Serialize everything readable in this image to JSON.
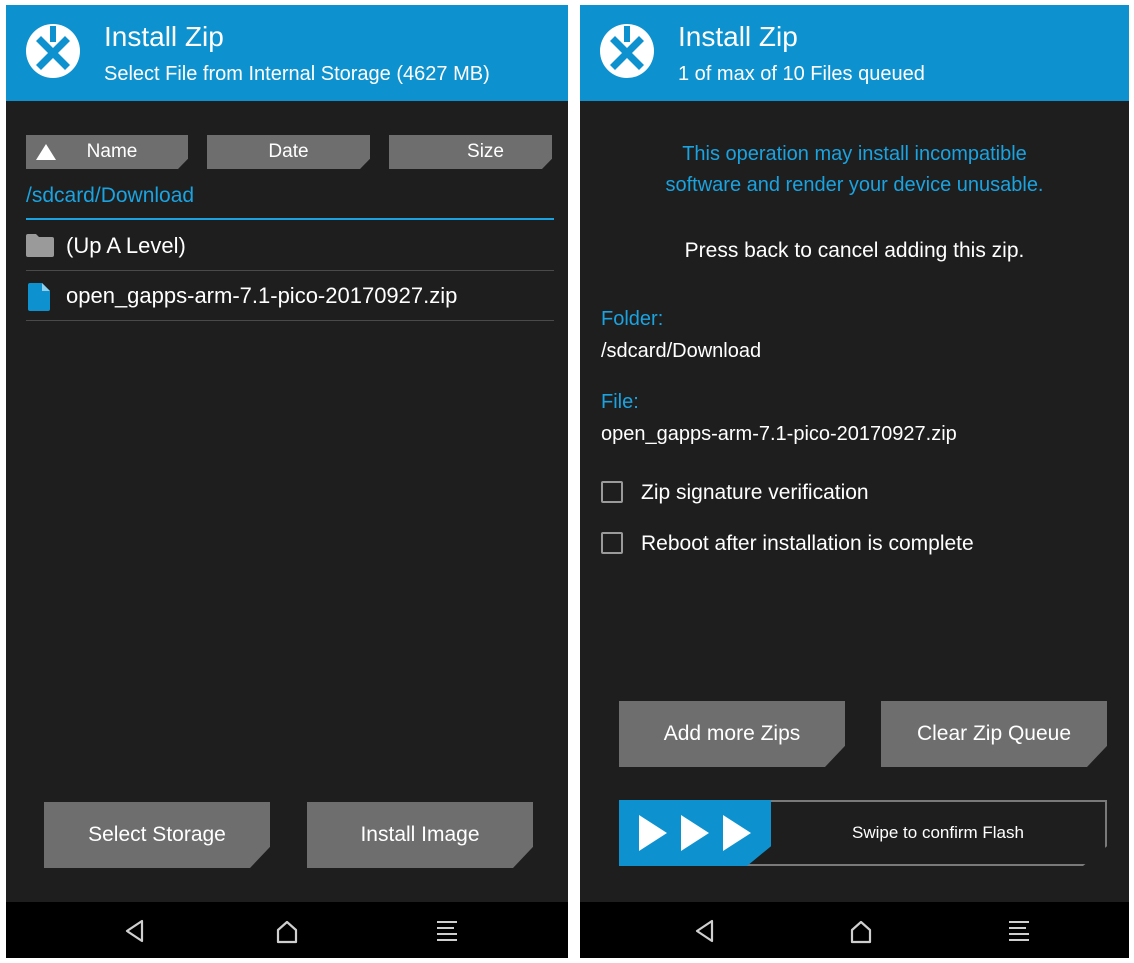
{
  "left": {
    "header": {
      "title": "Install Zip",
      "subtitle": "Select File from Internal Storage (4627 MB)"
    },
    "sort": {
      "name": "Name",
      "date": "Date",
      "size": "Size"
    },
    "path": "/sdcard/Download",
    "files": [
      {
        "name": "(Up A Level)",
        "icon": "folder-icon"
      },
      {
        "name": "open_gapps-arm-7.1-pico-20170927.zip",
        "icon": "file-icon"
      }
    ],
    "buttons": {
      "select_storage": "Select Storage",
      "install_image": "Install Image"
    }
  },
  "right": {
    "header": {
      "title": "Install Zip",
      "subtitle": "1 of max of 10 Files queued"
    },
    "warning": "This operation may install incompatible software and render your device unusable.",
    "warning_line1": "This operation may install incompatible",
    "warning_line2": "software and render your device unusable.",
    "press_back": "Press back to cancel adding this zip.",
    "folder_label": "Folder:",
    "folder_value": "/sdcard/Download",
    "file_label": "File:",
    "file_value": "open_gapps-arm-7.1-pico-20170927.zip",
    "options": [
      {
        "label": "Zip signature verification",
        "checked": false
      },
      {
        "label": "Reboot after installation is complete",
        "checked": false
      }
    ],
    "buttons": {
      "add_more": "Add more Zips",
      "clear_queue": "Clear Zip Queue"
    },
    "swipe_text": "Swipe to confirm Flash"
  },
  "colors": {
    "accent": "#0e92cf",
    "background": "#1e1e1e",
    "button": "#6e6e6e"
  }
}
